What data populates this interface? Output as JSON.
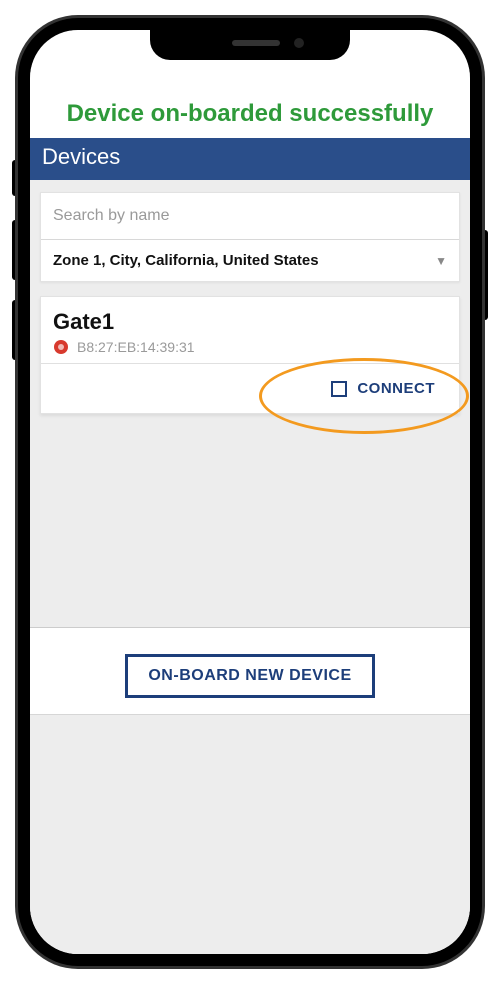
{
  "success_message": "Device on-boarded successfully",
  "header": {
    "title": "Devices"
  },
  "search": {
    "placeholder": "Search by name",
    "value": ""
  },
  "zone": {
    "selected": "Zone 1, City, California, United States"
  },
  "device": {
    "name": "Gate1",
    "mac": "B8:27:EB:14:39:31",
    "connect_label": "CONNECT"
  },
  "footer": {
    "onboard_label": "ON-BOARD NEW DEVICE"
  }
}
